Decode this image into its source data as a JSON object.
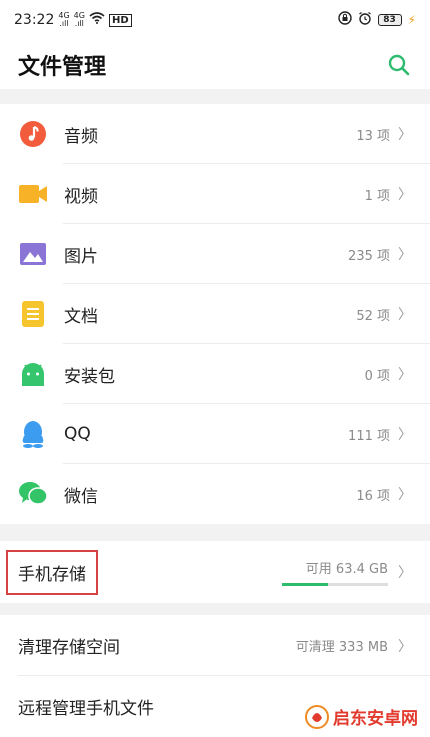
{
  "status_bar": {
    "time": "23:22",
    "signal1": "4G\n.ıll",
    "signal2": "4G\n.ıll",
    "network": "HD",
    "battery": "83"
  },
  "header": {
    "title": "文件管理",
    "search_icon": "search-icon"
  },
  "categories": [
    {
      "label": "音频",
      "count": "13 项",
      "icon": "music-icon",
      "color": "#f25c3c"
    },
    {
      "label": "视频",
      "count": "1 项",
      "icon": "video-icon",
      "color": "#f7b228"
    },
    {
      "label": "图片",
      "count": "235 项",
      "icon": "image-icon",
      "color": "#8a75d6"
    },
    {
      "label": "文档",
      "count": "52 项",
      "icon": "document-icon",
      "color": "#f6c52e"
    },
    {
      "label": "安装包",
      "count": "0 项",
      "icon": "android-icon",
      "color": "#35c56d"
    },
    {
      "label": "QQ",
      "count": "111 项",
      "icon": "qq-icon",
      "color": "#3c9cf0"
    },
    {
      "label": "微信",
      "count": "16 项",
      "icon": "wechat-icon",
      "color": "#32c466"
    }
  ],
  "storage": {
    "label": "手机存储",
    "available": "可用 63.4 GB",
    "used_fraction": 0.43,
    "accent": "#2dbb6e",
    "highlight": "#d64141"
  },
  "bottom_items": [
    {
      "label": "清理存储空间",
      "count": "可清理 333 MB"
    },
    {
      "label": "远程管理手机文件",
      "count": ""
    }
  ],
  "watermark": {
    "text": "启东安卓网"
  },
  "chevron": "〉"
}
